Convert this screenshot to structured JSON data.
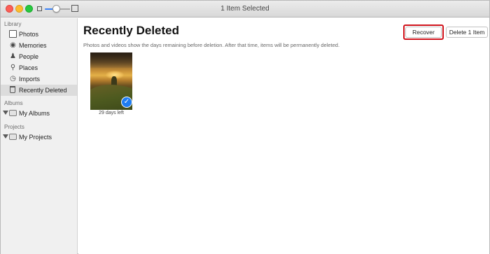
{
  "window": {
    "title": "1 Item Selected"
  },
  "sidebar": {
    "sections": [
      {
        "label": "Library"
      },
      {
        "label": "Albums"
      },
      {
        "label": "Projects"
      }
    ],
    "library_items": [
      {
        "label": "Photos",
        "icon": "photos-icon"
      },
      {
        "label": "Memories",
        "icon": "memories-icon"
      },
      {
        "label": "People",
        "icon": "person-icon"
      },
      {
        "label": "Places",
        "icon": "pin-icon"
      },
      {
        "label": "Imports",
        "icon": "clock-icon"
      },
      {
        "label": "Recently Deleted",
        "icon": "trash-icon",
        "selected": true
      }
    ],
    "albums": {
      "label": "My Albums",
      "icon": "folder-icon"
    },
    "projects": {
      "label": "My Projects",
      "icon": "folder-icon"
    }
  },
  "main": {
    "title": "Recently Deleted",
    "description": "Photos and videos show the days remaining before deletion. After that time, items will be permanently deleted.",
    "buttons": {
      "recover": "Recover",
      "delete": "Delete 1 Item"
    },
    "items": [
      {
        "caption": "29 days left",
        "selected": true
      }
    ]
  },
  "colors": {
    "accent": "#1e7cf2",
    "highlight": "#d0121b",
    "sidebar_bg": "#f0f0f0",
    "selected_bg": "#dcdcdc"
  }
}
